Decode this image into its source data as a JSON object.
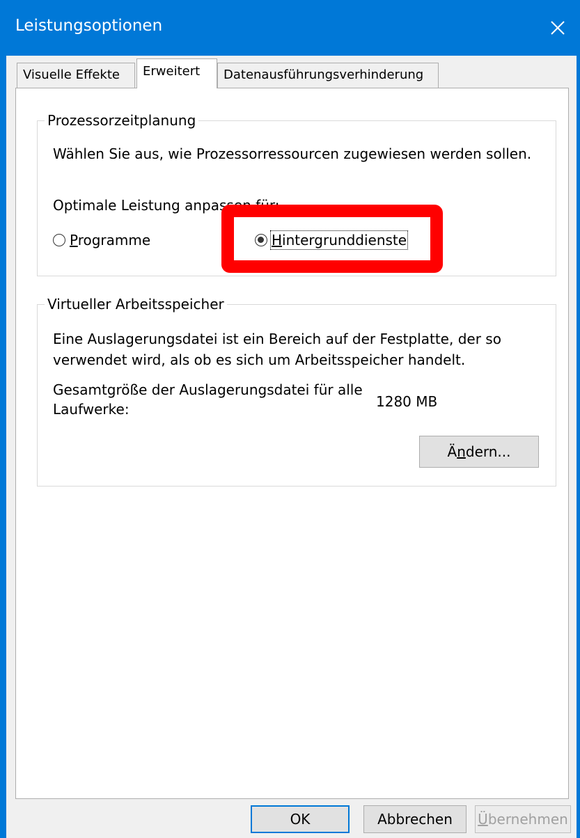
{
  "window": {
    "title": "Leistungsoptionen",
    "close_icon": "close-icon"
  },
  "tabs": [
    {
      "label": "Visuelle Effekte",
      "active": false
    },
    {
      "label": "Erweitert",
      "active": true
    },
    {
      "label": "Datenausführungsverhinderung",
      "active": false
    }
  ],
  "processor": {
    "group_title": "Prozessorzeitplanung",
    "description": "Wählen Sie aus, wie Prozessorressourcen zugewiesen werden sollen.",
    "adjust_label": "Optimale Leistung anpassen für:",
    "options": [
      {
        "label": "Programme",
        "mnemonic": "P",
        "rest": "rogramme",
        "checked": false
      },
      {
        "label": "Hintergrunddienste",
        "mnemonic": "H",
        "rest": "intergrunddienste",
        "checked": true
      }
    ]
  },
  "virtual_memory": {
    "group_title": "Virtueller Arbeitsspeicher",
    "description": "Eine Auslagerungsdatei ist ein Bereich auf der Festplatte, der so verwendet wird, als ob es sich um Arbeitsspeicher handelt.",
    "total_label_line1": "Gesamtgröße der Auslagerungsdatei für alle",
    "total_label_line2": "Laufwerke:",
    "total_value": "1280 MB",
    "change_button": {
      "prefix": "Ä",
      "mnemonic": "n",
      "rest": "dern..."
    }
  },
  "footer": {
    "ok": "OK",
    "cancel": "Abbrechen",
    "apply": {
      "mnemonic": "Ü",
      "rest": "bernehmen"
    }
  },
  "colors": {
    "accent": "#0078d7",
    "highlight": "#ff0000"
  }
}
